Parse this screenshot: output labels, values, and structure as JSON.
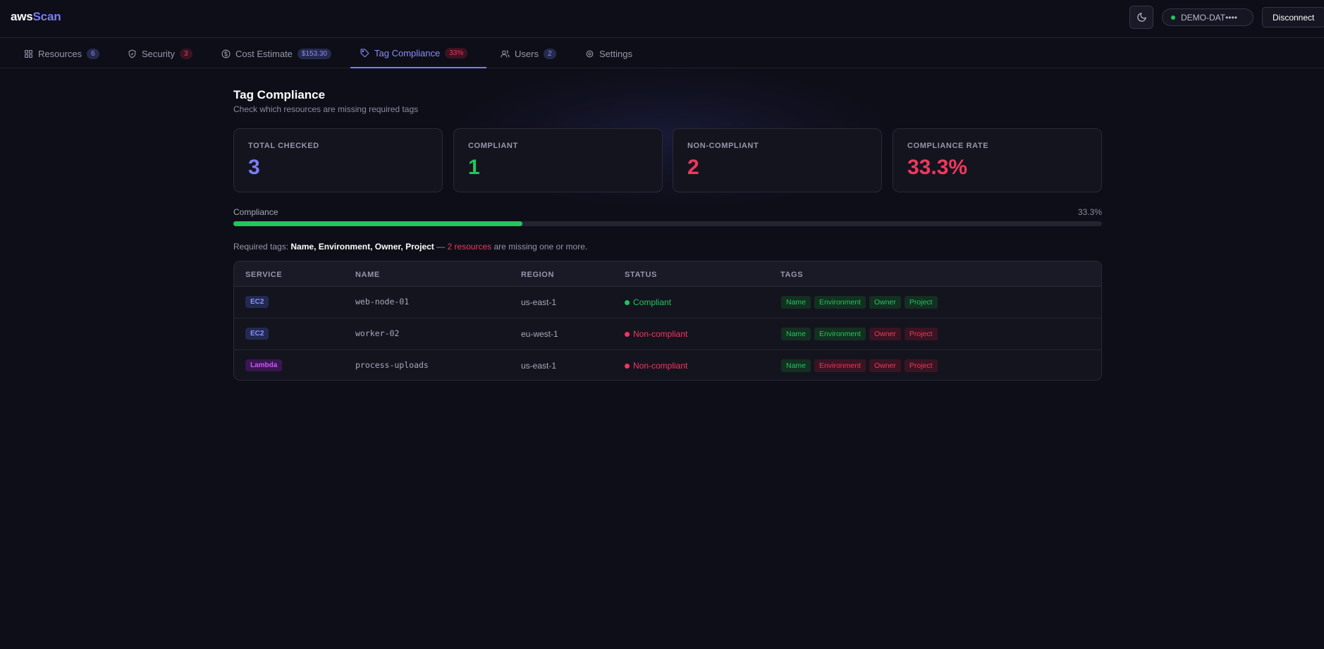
{
  "header": {
    "logo_part1": "aws",
    "logo_part2": "Scan",
    "account": "DEMO-DAT••••",
    "disconnect_label": "Disconnect"
  },
  "tabs": [
    {
      "label": "Resources",
      "badge": "6",
      "icon": "grid-icon"
    },
    {
      "label": "Security",
      "badge": "3",
      "icon": "shield-icon"
    },
    {
      "label": "Cost Estimate",
      "badge": "$153.30",
      "icon": "dollar-icon"
    },
    {
      "label": "Tag Compliance",
      "badge": "33%",
      "icon": "tag-icon"
    },
    {
      "label": "Users",
      "badge": "2",
      "icon": "users-icon"
    },
    {
      "label": "Settings",
      "badge": "",
      "icon": "gear-icon"
    }
  ],
  "page": {
    "title": "Tag Compliance",
    "subtitle": "Check which resources are missing required tags"
  },
  "stats": [
    {
      "label": "TOTAL CHECKED",
      "value": "3",
      "color": "#7b7cf5"
    },
    {
      "label": "COMPLIANT",
      "value": "1",
      "color": "#22c55e"
    },
    {
      "label": "NON-COMPLIANT",
      "value": "2",
      "color": "#f0385d"
    },
    {
      "label": "COMPLIANCE RATE",
      "value": "33.3%",
      "color": "#f0385d"
    }
  ],
  "progress": {
    "label": "Compliance",
    "percent_text": "33.3%",
    "fraction": 0.333
  },
  "required": {
    "prefix": "Required tags: ",
    "tags": "Name, Environment, Owner, Project",
    "dash": " — ",
    "missing": "2 resources",
    "suffix": " are missing one or more."
  },
  "table": {
    "headers": [
      "SERVICE",
      "NAME",
      "REGION",
      "STATUS",
      "TAGS"
    ],
    "rows": [
      {
        "service": "EC2",
        "name": "web-node-01",
        "region": "us-east-1",
        "status": "Compliant",
        "tags": [
          {
            "label": "Name",
            "ok": true
          },
          {
            "label": "Environment",
            "ok": true
          },
          {
            "label": "Owner",
            "ok": true
          },
          {
            "label": "Project",
            "ok": true
          }
        ]
      },
      {
        "service": "EC2",
        "name": "worker-02",
        "region": "eu-west-1",
        "status": "Non-compliant",
        "tags": [
          {
            "label": "Name",
            "ok": true
          },
          {
            "label": "Environment",
            "ok": true
          },
          {
            "label": "Owner",
            "ok": false
          },
          {
            "label": "Project",
            "ok": false
          }
        ]
      },
      {
        "service": "Lambda",
        "name": "process-uploads",
        "region": "us-east-1",
        "status": "Non-compliant",
        "tags": [
          {
            "label": "Name",
            "ok": true
          },
          {
            "label": "Environment",
            "ok": false
          },
          {
            "label": "Owner",
            "ok": false
          },
          {
            "label": "Project",
            "ok": false
          }
        ]
      }
    ]
  },
  "colors": {
    "accent": "#7b7cf5",
    "success": "#22c55e",
    "danger": "#f0385d",
    "background": "#0e0e18"
  }
}
